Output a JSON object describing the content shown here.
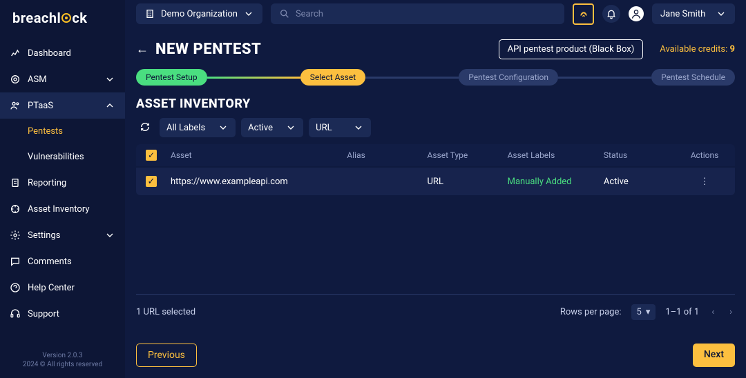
{
  "brand": "breachlock",
  "sidebar": {
    "items": [
      {
        "label": "Dashboard"
      },
      {
        "label": "ASM"
      },
      {
        "label": "PTaaS"
      },
      {
        "label": "Reporting"
      },
      {
        "label": "Asset Inventory"
      },
      {
        "label": "Settings"
      },
      {
        "label": "Comments"
      },
      {
        "label": "Help Center"
      },
      {
        "label": "Support"
      }
    ],
    "ptaas_sub": [
      {
        "label": "Pentests"
      },
      {
        "label": "Vulnerabilities"
      }
    ]
  },
  "footer": {
    "version": "Version 2.0.3",
    "copyright": "2024 © All rights reserved"
  },
  "topbar": {
    "org": "Demo Organization",
    "search_placeholder": "Search",
    "user": "Jane Smith"
  },
  "page": {
    "title": "NEW PENTEST",
    "product": "API pentest product (Black Box)",
    "credits_label": "Available credits:",
    "credits_value": "9"
  },
  "stepper": [
    {
      "label": "Pentest Setup"
    },
    {
      "label": "Select Asset"
    },
    {
      "label": "Pentest Configuration"
    },
    {
      "label": "Pentest Schedule"
    }
  ],
  "inventory": {
    "heading": "ASSET INVENTORY",
    "filters": {
      "labels": "All Labels",
      "status": "Active",
      "type": "URL"
    },
    "columns": {
      "asset": "Asset",
      "alias": "Alias",
      "type": "Asset Type",
      "labels": "Asset Labels",
      "status": "Status",
      "actions": "Actions"
    },
    "rows": [
      {
        "asset": "https://www.exampleapi.com",
        "alias": "",
        "type": "URL",
        "label": "Manually Added",
        "status": "Active"
      }
    ]
  },
  "table_footer": {
    "selected": "1 URL selected",
    "rpp_label": "Rows per page:",
    "rpp_value": "5",
    "range": "1–1 of 1"
  },
  "actions": {
    "previous": "Previous",
    "next": "Next"
  }
}
